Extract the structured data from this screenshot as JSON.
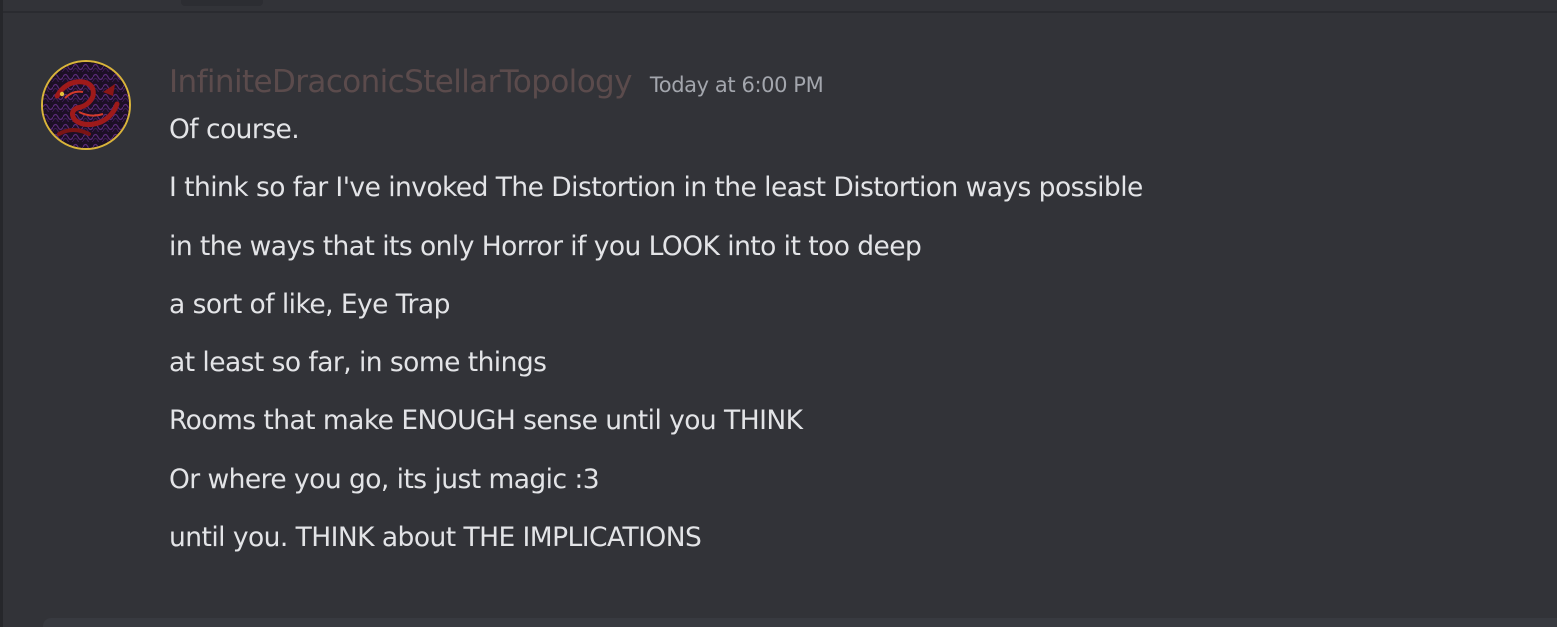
{
  "message": {
    "author": "InfiniteDraconicStellarTopology",
    "timestamp": "Today at 6:00 PM",
    "lines": [
      "Of course.",
      "I think so far I've invoked The Distortion in the least Distortion ways possible",
      "in the ways that its only Horror if you LOOK into it too deep",
      "a sort of like, Eye Trap",
      "at least so far, in some things",
      "Rooms that make ENOUGH sense until you THINK",
      "Or where you go, its just magic :3",
      "until you. THINK about THE IMPLICATIONS"
    ]
  },
  "colors": {
    "background": "#323338",
    "username": "#5b4b4c",
    "timestamp": "#a3a6ad",
    "text": "#e3e4e7",
    "avatar_border": "#d9b43a"
  },
  "icons": {
    "avatar": "red-dragon-on-purple-pattern"
  }
}
